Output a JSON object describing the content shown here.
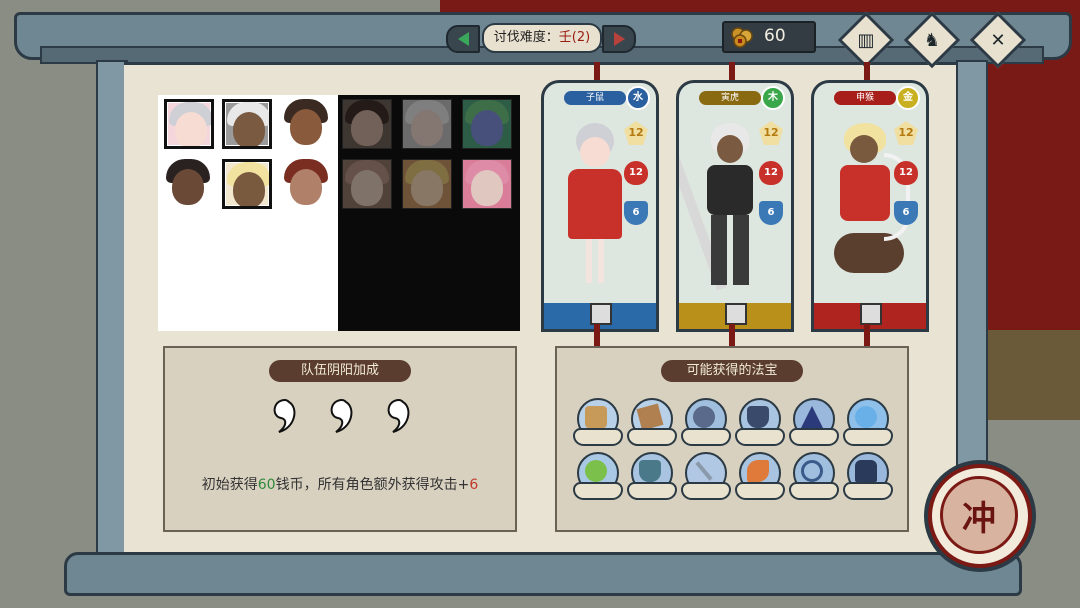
{
  "header": {
    "difficulty_label": "讨伐难度：",
    "difficulty_value": "壬(2)",
    "coins": "60"
  },
  "icons": {
    "prev": "arrow-left-icon",
    "next": "arrow-right-icon",
    "coin": "coin-icon",
    "book": "book-icon",
    "characters": "characters-icon",
    "close": "close-icon"
  },
  "roster": {
    "portraits": [
      {
        "name": "portrait-1",
        "state": "selected"
      },
      {
        "name": "portrait-2",
        "state": "selected"
      },
      {
        "name": "portrait-3",
        "state": "available"
      },
      {
        "name": "portrait-4",
        "state": "locked"
      },
      {
        "name": "portrait-5",
        "state": "locked"
      },
      {
        "name": "portrait-6",
        "state": "locked"
      },
      {
        "name": "portrait-7",
        "state": "available"
      },
      {
        "name": "portrait-8",
        "state": "selected"
      },
      {
        "name": "portrait-9",
        "state": "available"
      },
      {
        "name": "portrait-10",
        "state": "locked"
      },
      {
        "name": "portrait-11",
        "state": "locked"
      },
      {
        "name": "portrait-12",
        "state": "locked"
      }
    ]
  },
  "cards": [
    {
      "name": "子鼠",
      "element": "水",
      "attack": "12",
      "hp": "12",
      "defense": "6",
      "color": "#2a5fa0"
    },
    {
      "name": "寅虎",
      "element": "木",
      "attack": "12",
      "hp": "12",
      "defense": "6",
      "color": "#8a6a10"
    },
    {
      "name": "申猴",
      "element": "金",
      "attack": "12",
      "hp": "12",
      "defense": "6",
      "color": "#a81e1a"
    }
  ],
  "yinyang": {
    "title": "队伍阴阳加成",
    "effect_prefix": "初始获得",
    "effect_coins": "60",
    "effect_mid": "钱币，所有角色额外获得攻击+",
    "effect_attack": "6"
  },
  "treasures": {
    "title": "可能获得的法宝",
    "items": [
      "scroll-treasure",
      "map-treasure",
      "net-treasure",
      "urn-treasure",
      "hat-treasure",
      "crystal-ball-treasure",
      "gourd-treasure",
      "cauldron-treasure",
      "sword-treasure",
      "fish-treasure",
      "rope-treasure",
      "armor-treasure"
    ]
  },
  "charge_button": "冲"
}
